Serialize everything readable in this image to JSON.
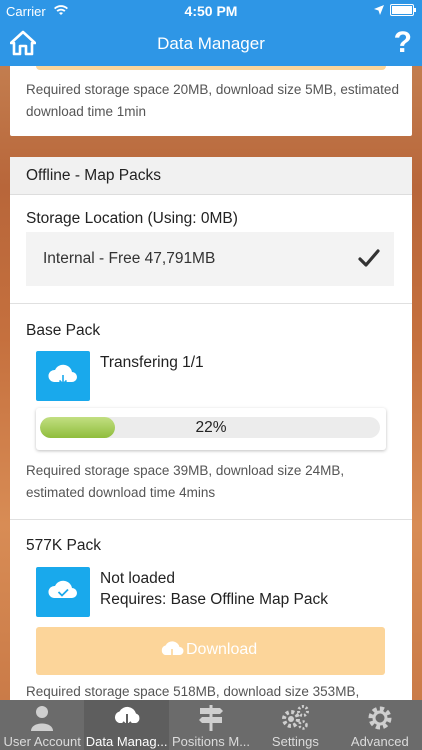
{
  "status_bar": {
    "carrier": "Carrier",
    "time": "4:50 PM"
  },
  "nav": {
    "title": "Data Manager",
    "help_glyph": "?"
  },
  "colors": {
    "accent": "#2e96e6",
    "icon_blue": "#19a9ec",
    "download_button": "#fcd59a",
    "progress_green": "#8fbd3c",
    "tab_bar": "#6b6b6b"
  },
  "previous_card": {
    "requirements": "Required storage space 20MB, download size 5MB, estimated download time 1min"
  },
  "offline_section": {
    "heading": "Offline - Map Packs",
    "storage_label": "Storage Location (Using: 0MB)",
    "storage_value": "Internal - Free 47,791MB",
    "storage_selected_icon": "checkmark-icon"
  },
  "base_pack": {
    "title": "Base Pack",
    "status": "Transfering 1/1",
    "progress": 0.22,
    "progress_text": "22%",
    "requirements": "Required storage space 39MB, download size 24MB, estimated download time 4mins"
  },
  "pack_577k": {
    "title": "577K Pack",
    "status_line1": "Not loaded",
    "status_line2": "Requires: Base Offline Map Pack",
    "download_label": "Download",
    "requirements": "Required storage space 518MB, download size 353MB,"
  },
  "tabs": [
    {
      "label": "User Account",
      "icon": "user-icon",
      "active": false
    },
    {
      "label": "Data Manag...",
      "icon": "cloud-download-icon",
      "active": true
    },
    {
      "label": "Positions M...",
      "icon": "signpost-icon",
      "active": false
    },
    {
      "label": "Settings",
      "icon": "gears-icon",
      "active": false
    },
    {
      "label": "Advanced",
      "icon": "gear-icon",
      "active": false
    }
  ]
}
